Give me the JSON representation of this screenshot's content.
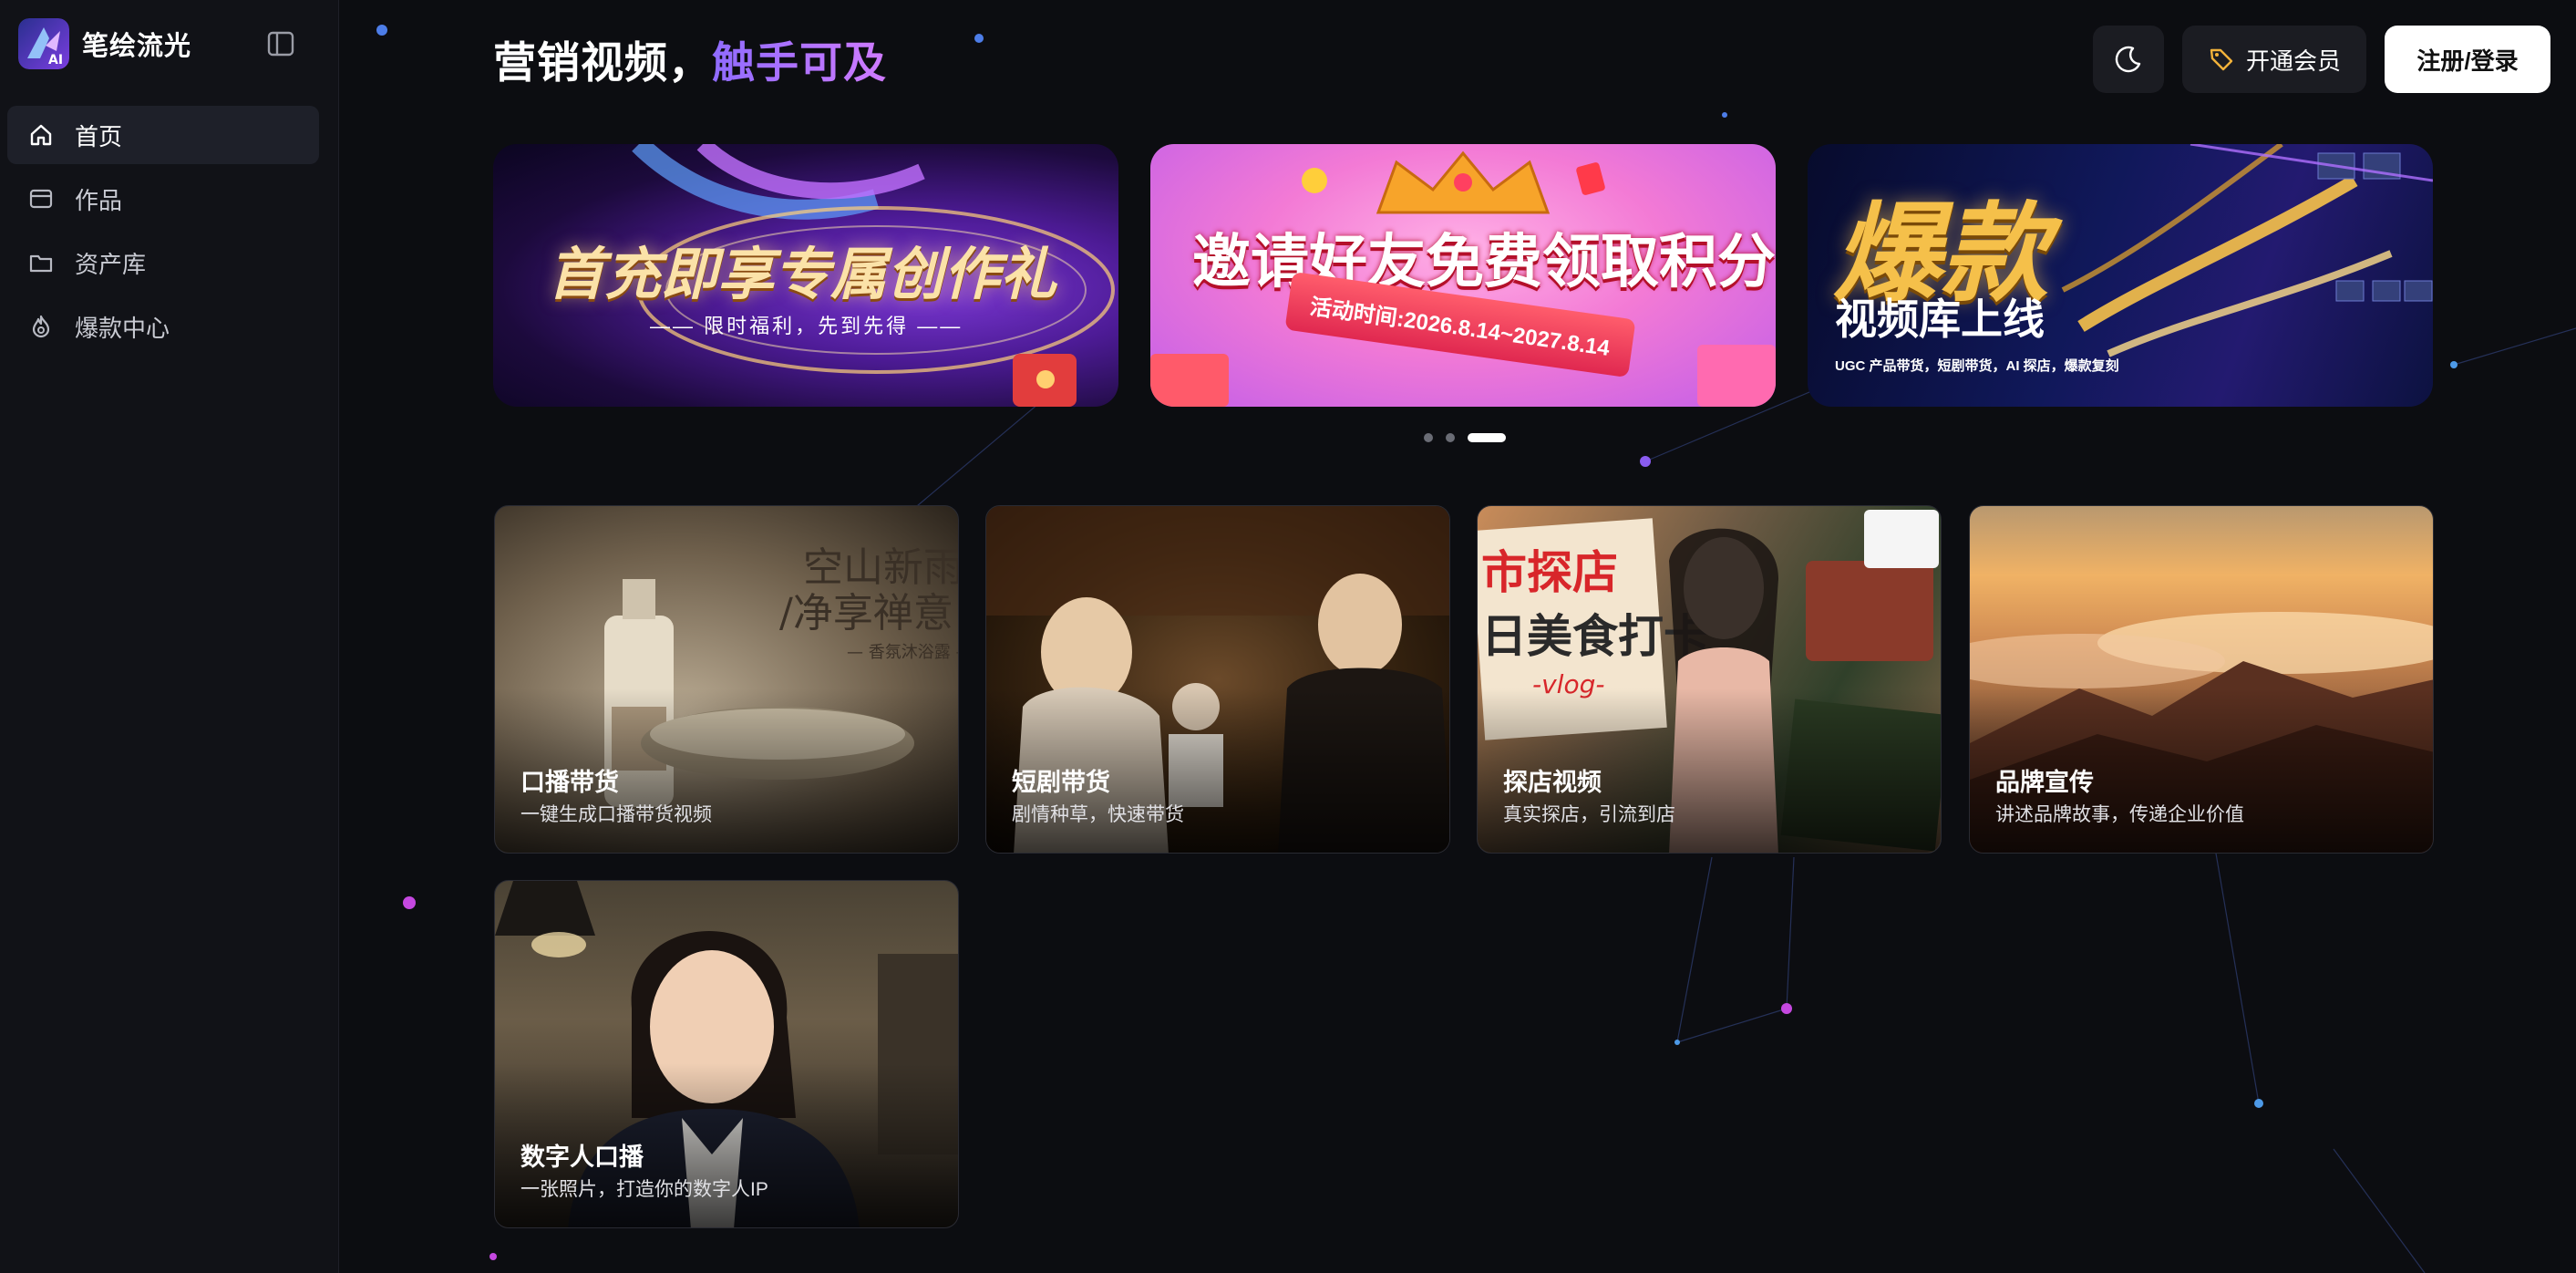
{
  "app": {
    "name": "笔绘流光"
  },
  "sidebar": {
    "items": [
      {
        "label": "首页",
        "icon": "home-icon",
        "active": true
      },
      {
        "label": "作品",
        "icon": "works-icon",
        "active": false
      },
      {
        "label": "资产库",
        "icon": "folder-icon",
        "active": false
      },
      {
        "label": "爆款中心",
        "icon": "flame-icon",
        "active": false
      }
    ]
  },
  "header": {
    "title_main": "营销视频，",
    "title_accent": "触手可及",
    "vip_label": "开通会员",
    "login_label": "注册/登录"
  },
  "banners": [
    {
      "title": "首充即享专属创作礼",
      "subtitle": "—— 限时福利，先到先得 ——"
    },
    {
      "title": "邀请好友免费领取积分",
      "subtitle": "活动时间:2026.8.14~2027.8.14"
    },
    {
      "title": "爆款",
      "subtitle": "视频库上线",
      "tags": "UGC 产品带货，短剧带货，AI 探店，爆款复刻"
    }
  ],
  "carousel": {
    "active_index": 2,
    "count": 3
  },
  "cards": [
    {
      "title": "口播带货",
      "desc": "一键生成口播带货视频",
      "overlay": "空山新雨/净享禅意",
      "overlay_sub": "— 香氛沐浴露 —"
    },
    {
      "title": "短剧带货",
      "desc": "剧情种草，快速带货"
    },
    {
      "title": "探店视频",
      "desc": "真实探店，引流到店",
      "overlay": "城市探店 日美食打卡",
      "overlay_tag": "vlog"
    },
    {
      "title": "品牌宣传",
      "desc": "讲述品牌故事，传递企业价值"
    },
    {
      "title": "数字人口播",
      "desc": "一张照片，打造你的数字人IP"
    }
  ],
  "colors": {
    "accent_start": "#8f6bff",
    "accent_end": "#d07bff",
    "background": "#0c0d11"
  }
}
